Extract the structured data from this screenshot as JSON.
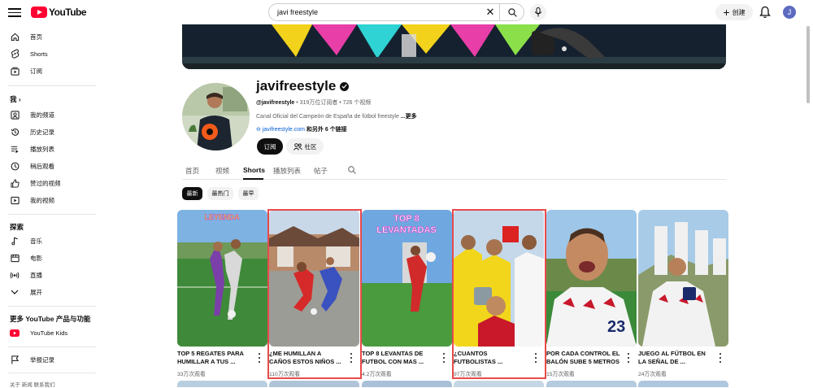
{
  "header": {
    "logo_text": "YouTube",
    "search_value": "javi freestyle",
    "create_label": "创建",
    "user_initial": "J"
  },
  "sidebar": {
    "main": [
      {
        "label": "首页",
        "icon": "home-icon"
      },
      {
        "label": "Shorts",
        "icon": "shorts-icon"
      },
      {
        "label": "订阅",
        "icon": "subscriptions-icon"
      }
    ],
    "you_heading": "我 ›",
    "you": [
      {
        "label": "我的频道",
        "icon": "channel-icon"
      },
      {
        "label": "历史记录",
        "icon": "history-icon"
      },
      {
        "label": "播放列表",
        "icon": "playlists-icon"
      },
      {
        "label": "稍后观看",
        "icon": "watch-later-icon"
      },
      {
        "label": "赞过的视频",
        "icon": "like-icon"
      },
      {
        "label": "我的视频",
        "icon": "your-videos-icon"
      }
    ],
    "explore_heading": "探索",
    "explore": [
      {
        "label": "音乐",
        "icon": "music-icon"
      },
      {
        "label": "电影",
        "icon": "movies-icon"
      },
      {
        "label": "直播",
        "icon": "live-icon"
      },
      {
        "label": "展开",
        "icon": "chevron-down-icon"
      }
    ],
    "more_heading": "更多 YouTube 产品与功能",
    "more": [
      {
        "label": "YouTube Kids",
        "icon": "youtube-kids-icon"
      }
    ],
    "report_label": "举报记录",
    "footer": "关于  新闻  联系我们"
  },
  "channel": {
    "name": "javifreestyle",
    "handle": "@javifreestyle",
    "stats": " • 319万位订阅者 • 726 个视频",
    "description": "Canal Oficial del Campeón de España de fútbol freestyle ",
    "description_more": "...更多",
    "link": "javifreestyle.com",
    "link_other": " 和另外 6 个链接",
    "subscribe_label": "订阅",
    "community_label": "社区"
  },
  "tabs": [
    "首页",
    "视频",
    "Shorts",
    "播放列表",
    "帖子"
  ],
  "active_tab": "Shorts",
  "chips": [
    "最新",
    "最热门",
    "最早"
  ],
  "shorts": [
    {
      "title": "TOP 5 REGATES PARA HUMILLAR A TUS ...",
      "views": "33万次观看",
      "overlay": "LEYENDA",
      "highlighted": false
    },
    {
      "title": "¿ME HUMILLAN A CAÑOS ESTOS NIÑOS ...",
      "views": "110万次观看",
      "overlay": "",
      "highlighted": true
    },
    {
      "title": "TOP 8 LEVANTAS DE FUTBOL CON MAS ...",
      "views": "4.2万次观看",
      "overlay": "TOP 8 LEVANTADAS",
      "highlighted": false
    },
    {
      "title": "¿CUANTOS FUTBOLISTAS ...",
      "views": "97万次观看",
      "overlay": "",
      "highlighted": true
    },
    {
      "title": "POR CADA CONTROL EL BALÓN SUBE 5 METROS",
      "views": "15万次观看",
      "overlay": "",
      "highlighted": false
    },
    {
      "title": "JUEGO AL FÚTBOL EN LA SEÑAL DE ...",
      "views": "24万次观看",
      "overlay": "",
      "highlighted": false
    }
  ],
  "colors": {
    "brand_red": "#ff0033",
    "link_blue": "#065fd4",
    "highlight_red": "#e84a4a"
  }
}
